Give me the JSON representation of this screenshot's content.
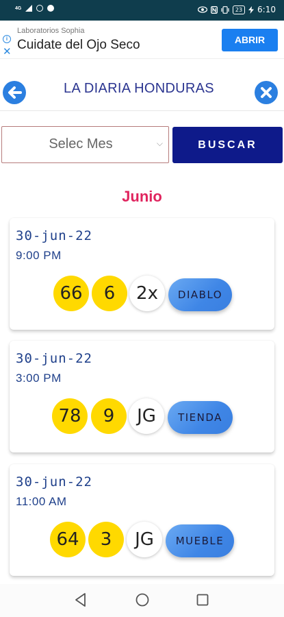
{
  "status_bar": {
    "network": "4G",
    "icons": [
      "signal-icon",
      "notification-circle-icon",
      "facebook-icon",
      "eye-icon",
      "nfc-icon",
      "vibrate-icon"
    ],
    "battery": "23",
    "time": "6:10"
  },
  "ad": {
    "sponsor": "Laboratorios Sophia",
    "title": "Cuidate del Ojo Seco",
    "button_label": "ABRIR"
  },
  "header": {
    "title": "LA DIARIA HONDURAS"
  },
  "controls": {
    "month_select_value": "Selec Mes",
    "search_label": "BUSCAR"
  },
  "month_heading": "Junio",
  "results": [
    {
      "date": "30-jun-22",
      "time": "9:00 PM",
      "num1": "66",
      "num2": "6",
      "multiplier": "2x",
      "word": "DIABLO"
    },
    {
      "date": "30-jun-22",
      "time": "3:00 PM",
      "num1": "78",
      "num2": "9",
      "multiplier": "JG",
      "word": "TIENDA"
    },
    {
      "date": "30-jun-22",
      "time": "11:00 AM",
      "num1": "64",
      "num2": "3",
      "multiplier": "JG",
      "word": "MUEBLE"
    }
  ],
  "colors": {
    "status_bar": "#0f3d4d",
    "accent_blue": "#2b7fe0",
    "search_button": "#0e1a8a",
    "month_heading": "#e0245e",
    "ball_yellow": "#ffd900"
  }
}
